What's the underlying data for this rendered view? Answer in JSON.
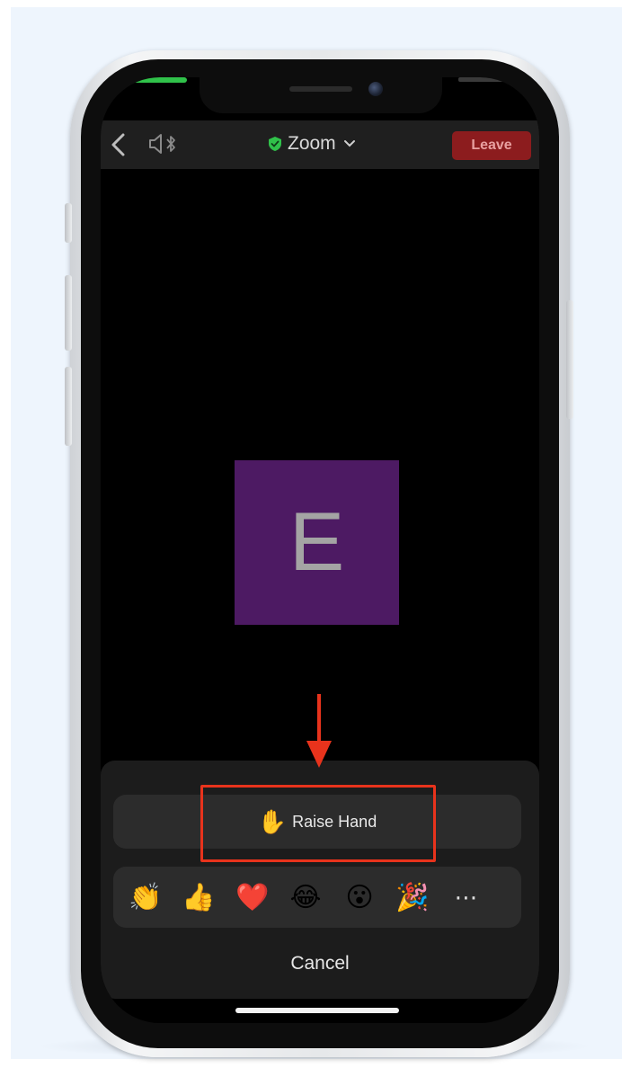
{
  "header": {
    "title": "Zoom",
    "leave_label": "Leave"
  },
  "participant": {
    "initial": "E"
  },
  "reaction_sheet": {
    "raise_hand_emoji": "✋",
    "raise_hand_label": "Raise Hand",
    "reactions": [
      {
        "name": "clap",
        "glyph": "👏"
      },
      {
        "name": "thumbs-up",
        "glyph": "👍"
      },
      {
        "name": "heart",
        "glyph": "❤️"
      },
      {
        "name": "tears-of-joy",
        "glyph": "😂"
      },
      {
        "name": "surprised",
        "glyph": "😮"
      },
      {
        "name": "party-popper",
        "glyph": "🎉"
      }
    ],
    "more_label": "⋯",
    "cancel_label": "Cancel"
  },
  "colors": {
    "leave_button": "#8c1c1e",
    "avatar_background": "#4d1a63",
    "annotation": "#e8331c",
    "encryption_shield": "#30c24a"
  }
}
